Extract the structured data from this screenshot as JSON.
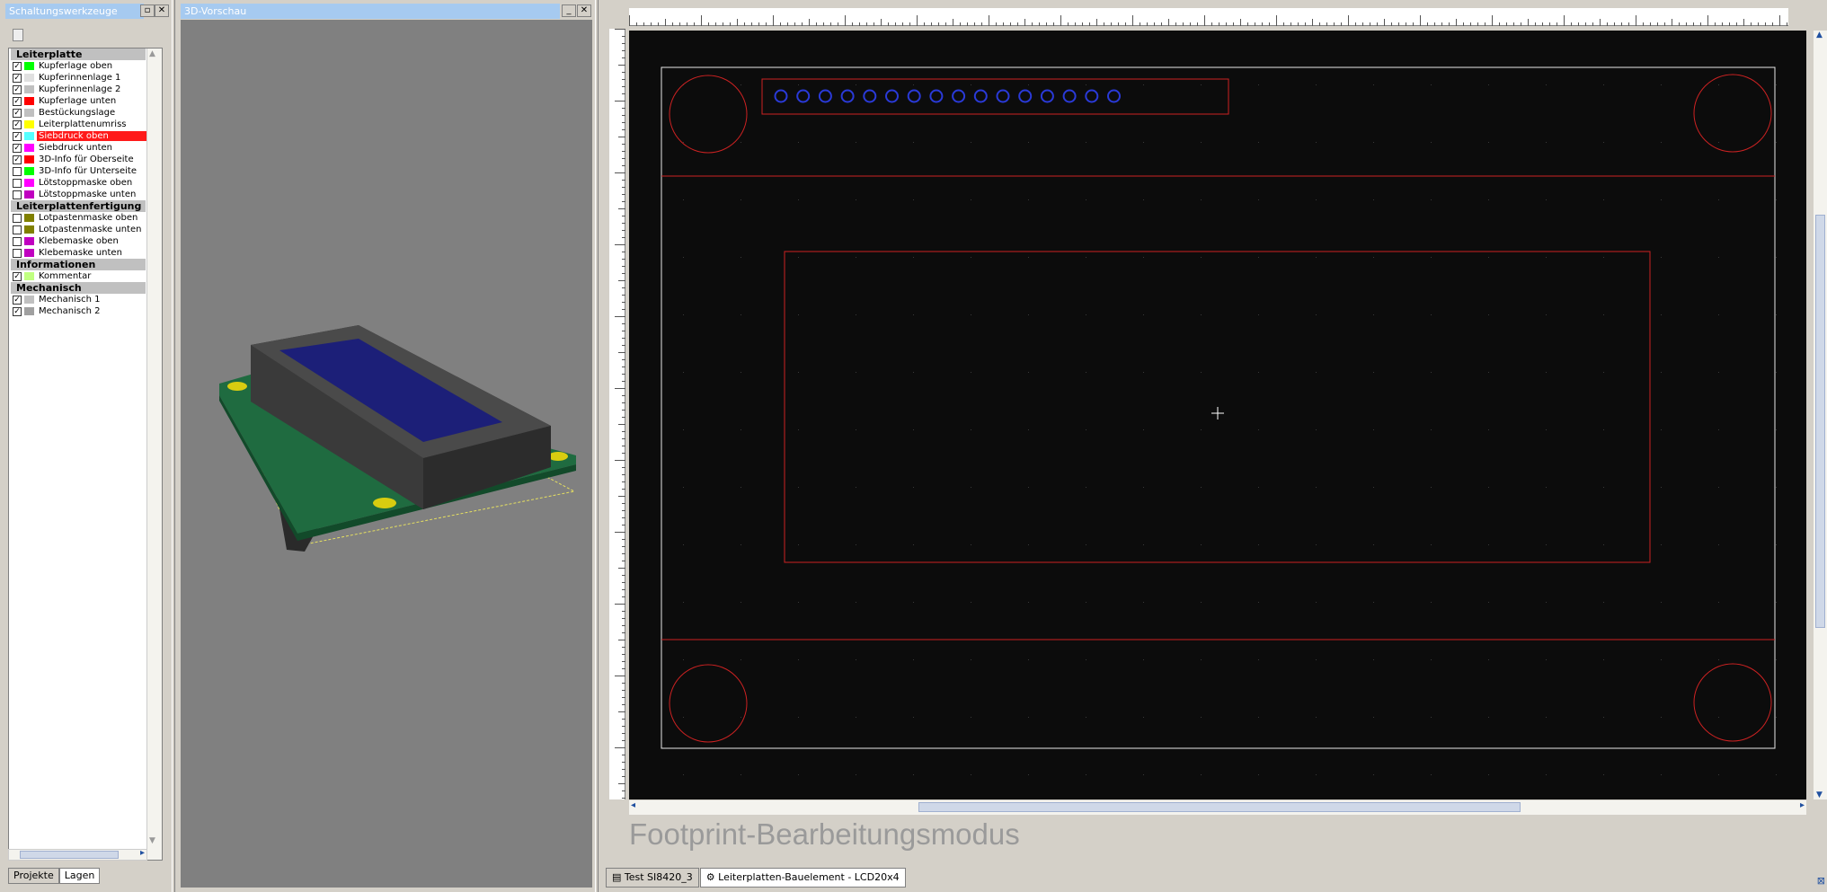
{
  "layers_panel": {
    "title": "Schaltungswerkzeuge",
    "groups": [
      {
        "name": "Leiterplatte",
        "items": [
          {
            "label": "Kupferlage oben",
            "checked": true,
            "color": "#00ff00"
          },
          {
            "label": "Kupferinnenlage 1",
            "checked": true,
            "color": "#e0e0e0"
          },
          {
            "label": "Kupferinnenlage 2",
            "checked": true,
            "color": "#c0c0c0"
          },
          {
            "label": "Kupferlage unten",
            "checked": true,
            "color": "#ff0000"
          },
          {
            "label": "Bestückungslage",
            "checked": true,
            "color": "#c0c0c0"
          },
          {
            "label": "Leiterplattenumriss",
            "checked": true,
            "color": "#ffff00"
          },
          {
            "label": "Siebdruck oben",
            "checked": true,
            "color": "#55ffff",
            "selected": true
          },
          {
            "label": "Siebdruck unten",
            "checked": true,
            "color": "#ff00ff"
          },
          {
            "label": "3D-Info für Oberseite",
            "checked": true,
            "color": "#ff0000"
          },
          {
            "label": "3D-Info für Unterseite",
            "checked": false,
            "color": "#00ff00"
          },
          {
            "label": "Lötstoppmaske oben",
            "checked": false,
            "color": "#ff00ff"
          },
          {
            "label": "Lötstoppmaske unten",
            "checked": false,
            "color": "#c000c0"
          }
        ]
      },
      {
        "name": "Leiterplattenfertigung",
        "items": [
          {
            "label": "Lotpastenmaske oben",
            "checked": false,
            "color": "#808000"
          },
          {
            "label": "Lotpastenmaske unten",
            "checked": false,
            "color": "#808000"
          },
          {
            "label": "Klebemaske oben",
            "checked": false,
            "color": "#c000c0"
          },
          {
            "label": "Klebemaske unten",
            "checked": false,
            "color": "#c000c0"
          }
        ]
      },
      {
        "name": "Informationen",
        "items": [
          {
            "label": "Kommentar",
            "checked": true,
            "color": "#c0ff80"
          }
        ]
      },
      {
        "name": "Mechanisch",
        "items": [
          {
            "label": "Mechanisch 1",
            "checked": true,
            "color": "#c0c0c0"
          },
          {
            "label": "Mechanisch 2",
            "checked": true,
            "color": "#a0a0a0"
          }
        ]
      }
    ],
    "tabs": [
      "Projekte",
      "Lagen"
    ]
  },
  "preview_panel": {
    "title": "3D-Vorschau"
  },
  "editor": {
    "mode_label": "Footprint-Bearbeitungsmodus",
    "doc_tabs": [
      "Test SI8420_3",
      "Leiterplatten-Bauelement - LCD20x4"
    ]
  }
}
